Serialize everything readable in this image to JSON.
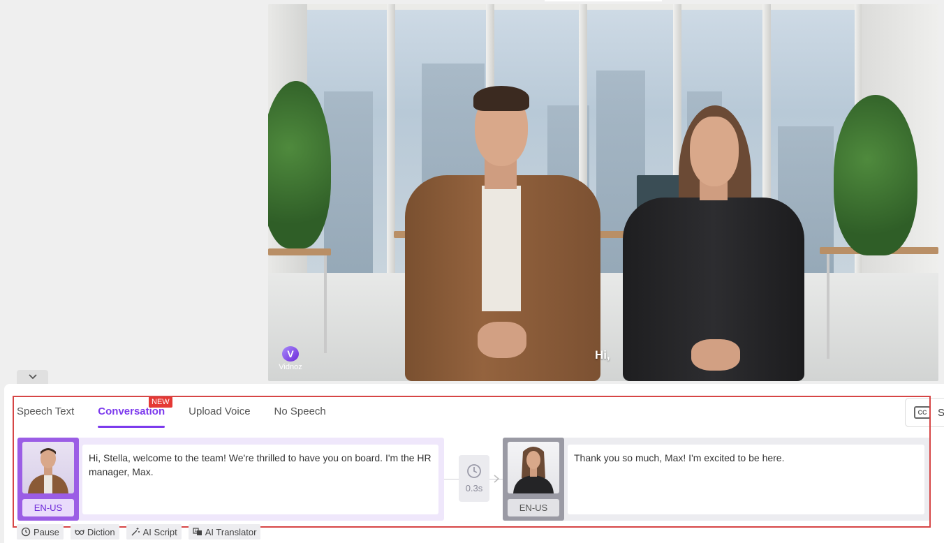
{
  "preview": {
    "caption": "Hi,",
    "watermark": "Vidnoz"
  },
  "tabs": [
    {
      "label": "Speech Text",
      "active": false
    },
    {
      "label": "Conversation",
      "active": true
    },
    {
      "label": "Upload Voice",
      "active": false
    },
    {
      "label": "No Speech",
      "active": false
    }
  ],
  "new_badge": "NEW",
  "subtitle_toggle": {
    "icon": "cc-icon",
    "label_partial": "S"
  },
  "conversation": {
    "lines": [
      {
        "speaker_avatar": "male-avatar",
        "language": "EN-US",
        "text": "Hi, Stella, welcome to the team! We're thrilled to have you on board. I'm the HR manager, Max."
      },
      {
        "speaker_avatar": "female-avatar",
        "language": "EN-US",
        "text": "Thank you so much, Max! I'm excited to be here."
      }
    ],
    "pause": {
      "icon": "clock-icon",
      "label": "0.3s"
    }
  },
  "toolbar": {
    "pause": "Pause",
    "diction": "Diction",
    "ai_script": "AI Script",
    "ai_translator": "AI Translator"
  },
  "colors": {
    "accent": "#7c3aed",
    "badge": "#e53935",
    "highlight_border": "#d64545"
  }
}
